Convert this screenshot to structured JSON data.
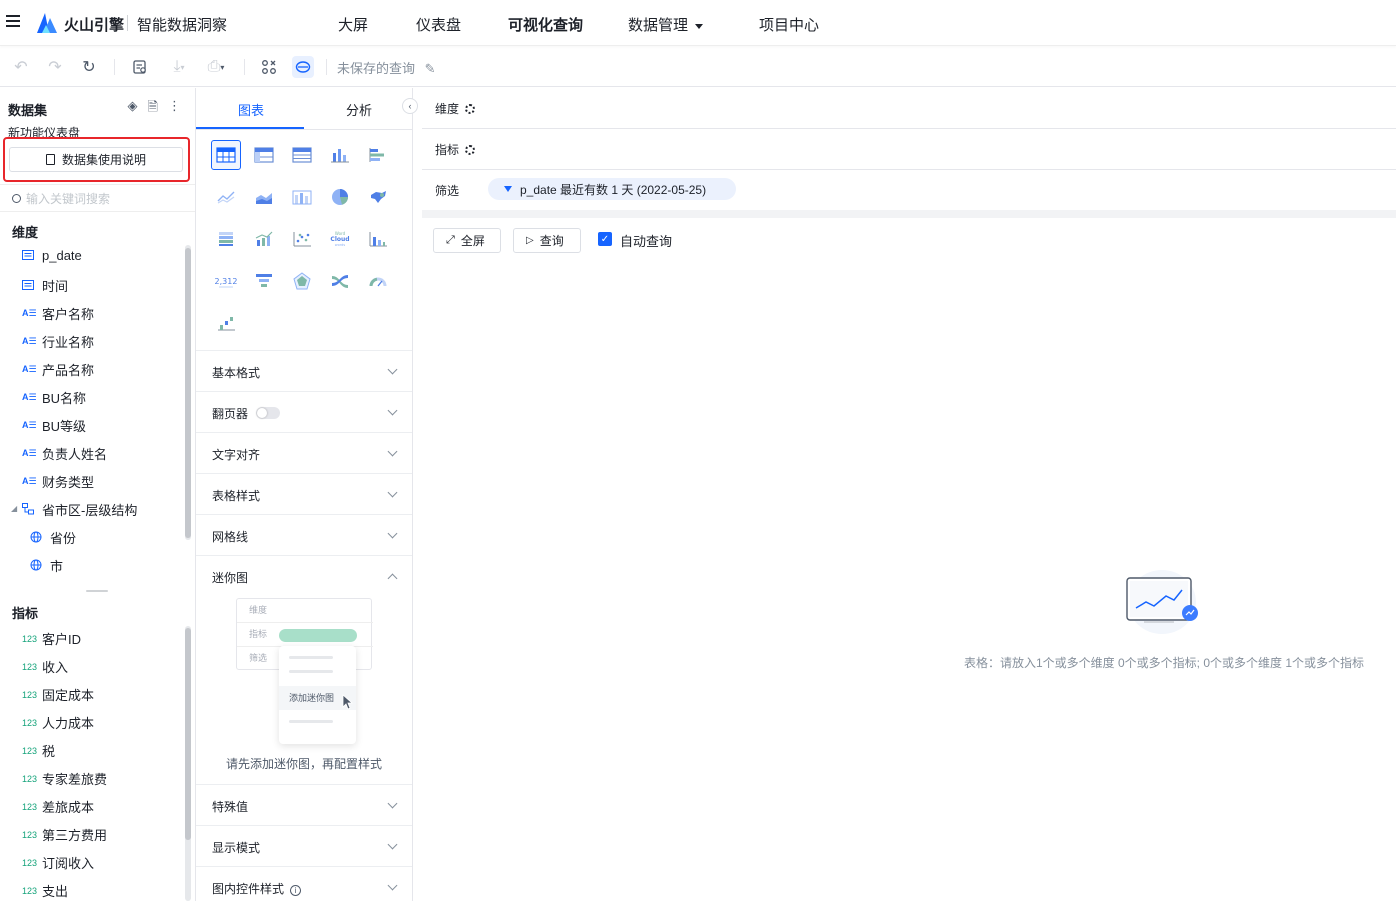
{
  "topnav": {
    "brand": "火山引擎",
    "product": "智能数据洞察",
    "items": [
      {
        "label": "大屏"
      },
      {
        "label": "仪表盘"
      },
      {
        "label": "可视化查询"
      },
      {
        "label": "数据管理"
      },
      {
        "label": "项目中心"
      }
    ]
  },
  "toolbar": {
    "unsaved_label": "未保存的查询"
  },
  "dataset": {
    "title": "数据集",
    "name": "新功能仪表盘",
    "guide_button": "数据集使用说明",
    "search_placeholder": "输入关键词搜索",
    "dimensions_title": "维度",
    "dimensions": [
      {
        "label": "p_date",
        "icon": "date-icon"
      },
      {
        "label": "时间",
        "icon": "date-icon"
      },
      {
        "label": "客户名称",
        "icon": "text-field-icon"
      },
      {
        "label": "行业名称",
        "icon": "text-field-icon"
      },
      {
        "label": "产品名称",
        "icon": "text-field-icon"
      },
      {
        "label": "BU名称",
        "icon": "text-field-icon"
      },
      {
        "label": "BU等级",
        "icon": "text-field-icon"
      },
      {
        "label": "负责人姓名",
        "icon": "text-field-icon"
      },
      {
        "label": "财务类型",
        "icon": "text-field-icon"
      },
      {
        "label": "省市区-层级结构",
        "icon": "hierarchy-icon"
      },
      {
        "label": "省份",
        "icon": "globe-icon"
      },
      {
        "label": "市",
        "icon": "globe-icon"
      }
    ],
    "metrics_title": "指标",
    "metrics": [
      {
        "label": "客户ID"
      },
      {
        "label": "收入"
      },
      {
        "label": "固定成本"
      },
      {
        "label": "人力成本"
      },
      {
        "label": "税"
      },
      {
        "label": "专家差旅费"
      },
      {
        "label": "差旅成本"
      },
      {
        "label": "第三方费用"
      },
      {
        "label": "订阅收入"
      },
      {
        "label": "支出"
      }
    ],
    "metric_icon_text": "123",
    "dim_icon_text": "A☰"
  },
  "config": {
    "tabs": [
      {
        "label": "图表"
      },
      {
        "label": "分析"
      }
    ],
    "sections": [
      {
        "label": "基本格式"
      },
      {
        "label": "翻页器"
      },
      {
        "label": "文字对齐"
      },
      {
        "label": "表格样式"
      },
      {
        "label": "网格线"
      },
      {
        "label": "迷你图"
      }
    ],
    "mini": {
      "rows": [
        "维度",
        "指标",
        "筛选"
      ],
      "add_label": "添加迷你图",
      "hint": "请先添加迷你图，再配置样式"
    },
    "lower_sections": [
      {
        "label": "特殊值"
      },
      {
        "label": "显示模式"
      },
      {
        "label": "图内控件样式"
      }
    ]
  },
  "query": {
    "dimension_label": "维度",
    "metric_label": "指标",
    "filter_label": "筛选",
    "filter_chip": "p_date 最近有数 1 天 (2022-05-25)",
    "fullscreen_button": "全屏",
    "query_button": "查询",
    "auto_query_label": "自动查询",
    "auto_query_checked": true,
    "empty_text": "表格：请放入1个或多个维度 0个或多个指标; 0个或多个维度 1个或多个指标"
  },
  "colors": {
    "accent": "#1664ff",
    "highlight_border": "#e8262b",
    "metric_icon": "#14a37a"
  }
}
